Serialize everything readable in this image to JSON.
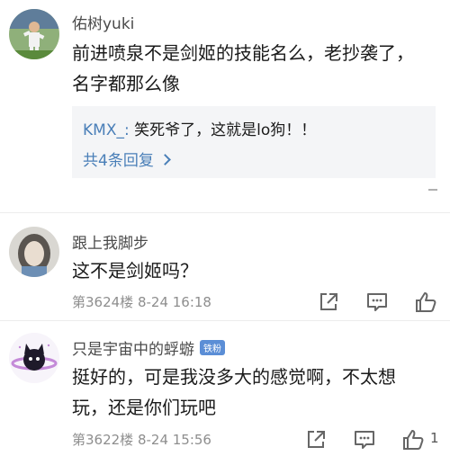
{
  "comments": [
    {
      "username": "佑树yuki",
      "line1": "前进喷泉不是剑姬的技能名么，老抄袭了，",
      "line2": "名字都那么像",
      "reply": {
        "user": "KMX_:",
        "text": " 笑死爷了，这就是lo狗！！",
        "more_label": "共4条回复"
      }
    },
    {
      "username": "跟上我脚步",
      "line1": "这不是剑姬吗？",
      "meta": "第3624楼  8-24 16:18"
    },
    {
      "username": "只是宇宙中的蜉蝣",
      "badge": "铁粉",
      "line1": "挺好的，可是我没多大的感觉啊，不太想",
      "line2": "玩，还是你们玩吧",
      "meta": "第3622楼  8-24 15:56",
      "likes": "1"
    }
  ],
  "icons": {
    "share": "share-icon",
    "comment": "comment-icon",
    "like": "thumbs-up-icon"
  },
  "colors": {
    "link": "#4a7fb8",
    "meta": "#8e8e8e",
    "reply_bg": "#f4f5f7",
    "badge": "#5b8ed6"
  }
}
